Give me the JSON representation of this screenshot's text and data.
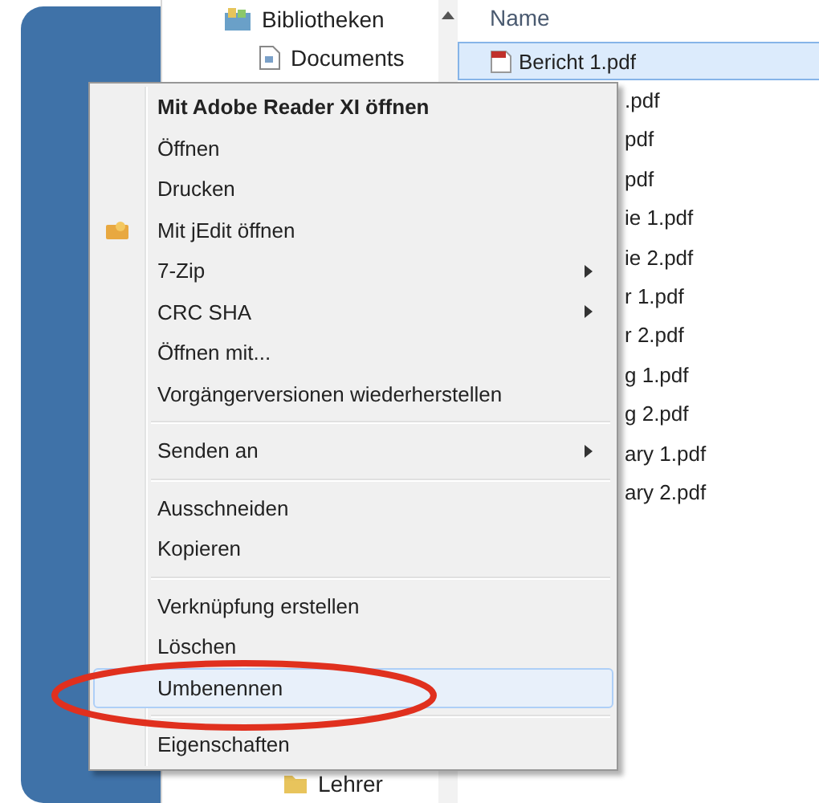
{
  "navigation": {
    "items": [
      {
        "label": "Bibliotheken",
        "kind": "library"
      },
      {
        "label": "Documents",
        "kind": "document"
      },
      {
        "label": "Lehrer",
        "kind": "folder"
      }
    ]
  },
  "file_list": {
    "column_header": "Name",
    "rows": [
      {
        "name": "Bericht 1.pdf",
        "kind": "full",
        "selected": true
      },
      {
        "name": ".pdf",
        "kind": "clipped",
        "selected": false
      },
      {
        "name": "pdf",
        "kind": "clipped",
        "selected": false
      },
      {
        "name": "pdf",
        "kind": "clipped",
        "selected": false
      },
      {
        "name": "ie 1.pdf",
        "kind": "clipped",
        "selected": false
      },
      {
        "name": "ie 2.pdf",
        "kind": "clipped",
        "selected": false
      },
      {
        "name": "r 1.pdf",
        "kind": "clipped",
        "selected": false
      },
      {
        "name": "r 2.pdf",
        "kind": "clipped",
        "selected": false
      },
      {
        "name": "g 1.pdf",
        "kind": "clipped",
        "selected": false
      },
      {
        "name": "g 2.pdf",
        "kind": "clipped",
        "selected": false
      },
      {
        "name": "ary 1.pdf",
        "kind": "clipped",
        "selected": false
      },
      {
        "name": "ary 2.pdf",
        "kind": "clipped",
        "selected": false
      }
    ]
  },
  "context_menu": {
    "items": [
      {
        "kind": "item",
        "label": "Mit Adobe Reader XI öffnen",
        "bold": true,
        "submenu": false,
        "has_icon": false,
        "selected": false
      },
      {
        "kind": "item",
        "label": "Öffnen",
        "bold": false,
        "submenu": false,
        "has_icon": false,
        "selected": false
      },
      {
        "kind": "item",
        "label": "Drucken",
        "bold": false,
        "submenu": false,
        "has_icon": false,
        "selected": false
      },
      {
        "kind": "item",
        "label": "Mit jEdit öffnen",
        "bold": false,
        "submenu": false,
        "has_icon": true,
        "selected": false
      },
      {
        "kind": "item",
        "label": "7-Zip",
        "bold": false,
        "submenu": true,
        "has_icon": false,
        "selected": false
      },
      {
        "kind": "item",
        "label": "CRC SHA",
        "bold": false,
        "submenu": true,
        "has_icon": false,
        "selected": false
      },
      {
        "kind": "item",
        "label": "Öffnen mit...",
        "bold": false,
        "submenu": false,
        "has_icon": false,
        "selected": false
      },
      {
        "kind": "item",
        "label": "Vorgängerversionen wiederherstellen",
        "bold": false,
        "submenu": false,
        "has_icon": false,
        "selected": false
      },
      {
        "kind": "separator"
      },
      {
        "kind": "item",
        "label": "Senden an",
        "bold": false,
        "submenu": true,
        "has_icon": false,
        "selected": false
      },
      {
        "kind": "separator"
      },
      {
        "kind": "item",
        "label": "Ausschneiden",
        "bold": false,
        "submenu": false,
        "has_icon": false,
        "selected": false
      },
      {
        "kind": "item",
        "label": "Kopieren",
        "bold": false,
        "submenu": false,
        "has_icon": false,
        "selected": false
      },
      {
        "kind": "separator"
      },
      {
        "kind": "item",
        "label": "Verknüpfung erstellen",
        "bold": false,
        "submenu": false,
        "has_icon": false,
        "selected": false
      },
      {
        "kind": "item",
        "label": "Löschen",
        "bold": false,
        "submenu": false,
        "has_icon": false,
        "selected": false
      },
      {
        "kind": "item",
        "label": "Umbenennen",
        "bold": false,
        "submenu": false,
        "has_icon": false,
        "selected": true
      },
      {
        "kind": "separator"
      },
      {
        "kind": "item",
        "label": "Eigenschaften",
        "bold": false,
        "submenu": false,
        "has_icon": false,
        "selected": false
      }
    ]
  }
}
